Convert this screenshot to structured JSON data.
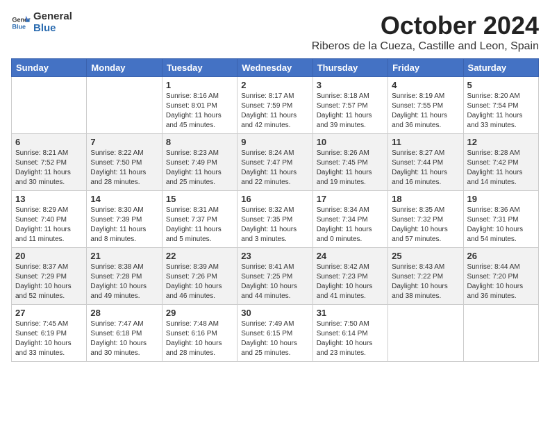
{
  "header": {
    "logo_general": "General",
    "logo_blue": "Blue",
    "month_title": "October 2024",
    "location": "Riberos de la Cueza, Castille and Leon, Spain"
  },
  "days_of_week": [
    "Sunday",
    "Monday",
    "Tuesday",
    "Wednesday",
    "Thursday",
    "Friday",
    "Saturday"
  ],
  "weeks": [
    [
      {
        "day": "",
        "info": ""
      },
      {
        "day": "",
        "info": ""
      },
      {
        "day": "1",
        "info": "Sunrise: 8:16 AM\nSunset: 8:01 PM\nDaylight: 11 hours and 45 minutes."
      },
      {
        "day": "2",
        "info": "Sunrise: 8:17 AM\nSunset: 7:59 PM\nDaylight: 11 hours and 42 minutes."
      },
      {
        "day": "3",
        "info": "Sunrise: 8:18 AM\nSunset: 7:57 PM\nDaylight: 11 hours and 39 minutes."
      },
      {
        "day": "4",
        "info": "Sunrise: 8:19 AM\nSunset: 7:55 PM\nDaylight: 11 hours and 36 minutes."
      },
      {
        "day": "5",
        "info": "Sunrise: 8:20 AM\nSunset: 7:54 PM\nDaylight: 11 hours and 33 minutes."
      }
    ],
    [
      {
        "day": "6",
        "info": "Sunrise: 8:21 AM\nSunset: 7:52 PM\nDaylight: 11 hours and 30 minutes."
      },
      {
        "day": "7",
        "info": "Sunrise: 8:22 AM\nSunset: 7:50 PM\nDaylight: 11 hours and 28 minutes."
      },
      {
        "day": "8",
        "info": "Sunrise: 8:23 AM\nSunset: 7:49 PM\nDaylight: 11 hours and 25 minutes."
      },
      {
        "day": "9",
        "info": "Sunrise: 8:24 AM\nSunset: 7:47 PM\nDaylight: 11 hours and 22 minutes."
      },
      {
        "day": "10",
        "info": "Sunrise: 8:26 AM\nSunset: 7:45 PM\nDaylight: 11 hours and 19 minutes."
      },
      {
        "day": "11",
        "info": "Sunrise: 8:27 AM\nSunset: 7:44 PM\nDaylight: 11 hours and 16 minutes."
      },
      {
        "day": "12",
        "info": "Sunrise: 8:28 AM\nSunset: 7:42 PM\nDaylight: 11 hours and 14 minutes."
      }
    ],
    [
      {
        "day": "13",
        "info": "Sunrise: 8:29 AM\nSunset: 7:40 PM\nDaylight: 11 hours and 11 minutes."
      },
      {
        "day": "14",
        "info": "Sunrise: 8:30 AM\nSunset: 7:39 PM\nDaylight: 11 hours and 8 minutes."
      },
      {
        "day": "15",
        "info": "Sunrise: 8:31 AM\nSunset: 7:37 PM\nDaylight: 11 hours and 5 minutes."
      },
      {
        "day": "16",
        "info": "Sunrise: 8:32 AM\nSunset: 7:35 PM\nDaylight: 11 hours and 3 minutes."
      },
      {
        "day": "17",
        "info": "Sunrise: 8:34 AM\nSunset: 7:34 PM\nDaylight: 11 hours and 0 minutes."
      },
      {
        "day": "18",
        "info": "Sunrise: 8:35 AM\nSunset: 7:32 PM\nDaylight: 10 hours and 57 minutes."
      },
      {
        "day": "19",
        "info": "Sunrise: 8:36 AM\nSunset: 7:31 PM\nDaylight: 10 hours and 54 minutes."
      }
    ],
    [
      {
        "day": "20",
        "info": "Sunrise: 8:37 AM\nSunset: 7:29 PM\nDaylight: 10 hours and 52 minutes."
      },
      {
        "day": "21",
        "info": "Sunrise: 8:38 AM\nSunset: 7:28 PM\nDaylight: 10 hours and 49 minutes."
      },
      {
        "day": "22",
        "info": "Sunrise: 8:39 AM\nSunset: 7:26 PM\nDaylight: 10 hours and 46 minutes."
      },
      {
        "day": "23",
        "info": "Sunrise: 8:41 AM\nSunset: 7:25 PM\nDaylight: 10 hours and 44 minutes."
      },
      {
        "day": "24",
        "info": "Sunrise: 8:42 AM\nSunset: 7:23 PM\nDaylight: 10 hours and 41 minutes."
      },
      {
        "day": "25",
        "info": "Sunrise: 8:43 AM\nSunset: 7:22 PM\nDaylight: 10 hours and 38 minutes."
      },
      {
        "day": "26",
        "info": "Sunrise: 8:44 AM\nSunset: 7:20 PM\nDaylight: 10 hours and 36 minutes."
      }
    ],
    [
      {
        "day": "27",
        "info": "Sunrise: 7:45 AM\nSunset: 6:19 PM\nDaylight: 10 hours and 33 minutes."
      },
      {
        "day": "28",
        "info": "Sunrise: 7:47 AM\nSunset: 6:18 PM\nDaylight: 10 hours and 30 minutes."
      },
      {
        "day": "29",
        "info": "Sunrise: 7:48 AM\nSunset: 6:16 PM\nDaylight: 10 hours and 28 minutes."
      },
      {
        "day": "30",
        "info": "Sunrise: 7:49 AM\nSunset: 6:15 PM\nDaylight: 10 hours and 25 minutes."
      },
      {
        "day": "31",
        "info": "Sunrise: 7:50 AM\nSunset: 6:14 PM\nDaylight: 10 hours and 23 minutes."
      },
      {
        "day": "",
        "info": ""
      },
      {
        "day": "",
        "info": ""
      }
    ]
  ]
}
